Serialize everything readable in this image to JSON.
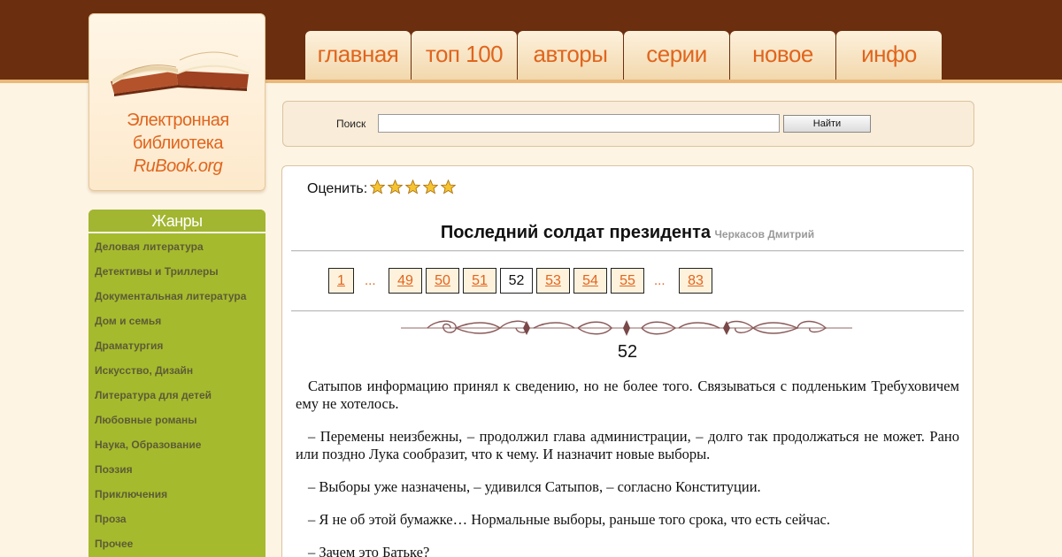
{
  "site": {
    "logo_line1": "Электронная",
    "logo_line2": "библиотека",
    "logo_line3": "RuBook.org"
  },
  "nav": {
    "tabs": [
      "главная",
      "топ 100",
      "авторы",
      "серии",
      "новое",
      "инфо"
    ]
  },
  "search": {
    "label": "Поиск",
    "value": "",
    "button": "Найти"
  },
  "genres": {
    "title": "Жанры",
    "items": [
      "Деловая литература",
      "Детективы и Триллеры",
      "Документальная литература",
      "Дом и семья",
      "Драматургия",
      "Искусство, Дизайн",
      "Литература для детей",
      "Любовные романы",
      "Наука, Образование",
      "Поэзия",
      "Приключения",
      "Проза",
      "Прочее"
    ]
  },
  "rating": {
    "label": "Оценить:",
    "stars": 5,
    "icon": "star-icon"
  },
  "book": {
    "title": "Последний солдат президента",
    "author": "Черкасов Дмитрий"
  },
  "pager": {
    "first": "1",
    "dots_left": "...",
    "pages": [
      "49",
      "50",
      "51",
      "52",
      "53",
      "54",
      "55"
    ],
    "current": "52",
    "dots_right": "...",
    "last": "83"
  },
  "chapter": {
    "number": "52",
    "paragraphs": [
      "Сатыпов информацию принял к сведению, но не более того. Связываться с подленьким Требуховичем ему не хотелось.",
      "– Перемены неизбежны, – продолжил глава администрации, – долго так продолжаться не может. Рано или поздно Лука сообразит, что к чему. И назначит новые выборы.",
      "– Выборы уже назначены, – удивился Сатыпов, – согласно Конституции.",
      "– Я не об этой бумажке… Нормальные выборы, раньше того срока, что есть сейчас.",
      "– Зачем это Батьке?"
    ]
  },
  "colors": {
    "header_bg": "#6b2e0f",
    "accent": "#e0651d",
    "genres_bg": "#a6ba2d",
    "page_bg": "#fdf4e4"
  }
}
